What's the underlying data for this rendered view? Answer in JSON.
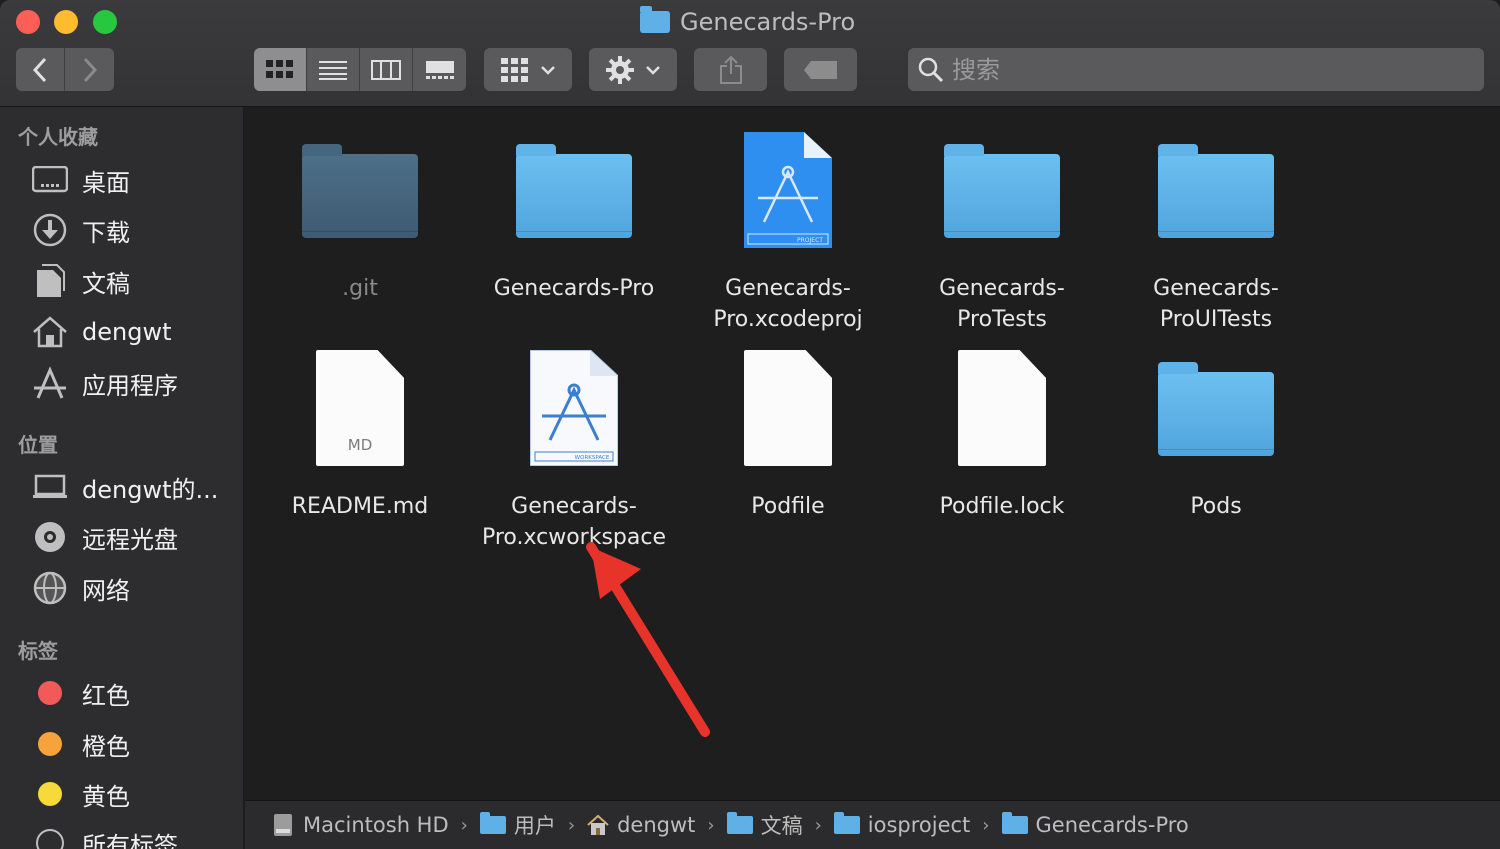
{
  "window": {
    "title": "Genecards-Pro"
  },
  "search": {
    "placeholder": "搜索"
  },
  "sidebar": {
    "sections": [
      {
        "heading": "个人收藏",
        "items": [
          {
            "label": "桌面",
            "icon": "desktop-icon"
          },
          {
            "label": "下载",
            "icon": "download-icon"
          },
          {
            "label": "文稿",
            "icon": "documents-icon"
          },
          {
            "label": "dengwt",
            "icon": "home-icon"
          },
          {
            "label": "应用程序",
            "icon": "applications-icon"
          }
        ]
      },
      {
        "heading": "位置",
        "items": [
          {
            "label": "dengwt的...",
            "icon": "laptop-icon"
          },
          {
            "label": "远程光盘",
            "icon": "disc-icon"
          },
          {
            "label": "网络",
            "icon": "network-icon"
          }
        ]
      },
      {
        "heading": "标签",
        "items": [
          {
            "label": "红色",
            "color": "#f25a5a"
          },
          {
            "label": "橙色",
            "color": "#f7a33c"
          },
          {
            "label": "黄色",
            "color": "#f7d93a"
          },
          {
            "label": "所有标签...",
            "icon": "tag-icon"
          }
        ]
      }
    ]
  },
  "files": [
    {
      "name": ".git",
      "kind": "folder-dark"
    },
    {
      "name": "Genecards-Pro",
      "kind": "folder"
    },
    {
      "name": "Genecards-\nPro.xcodeproj",
      "kind": "xcodeproj",
      "badge": "PROJECT"
    },
    {
      "name": "Genecards-\nProTests",
      "kind": "folder"
    },
    {
      "name": "Genecards-\nProUITests",
      "kind": "folder"
    },
    {
      "name": "README.md",
      "kind": "md",
      "badge": "MD"
    },
    {
      "name": "Genecards-\nPro.xcworkspace",
      "kind": "xcworkspace",
      "badge": "WORKSPACE"
    },
    {
      "name": "Podfile",
      "kind": "doc"
    },
    {
      "name": "Podfile.lock",
      "kind": "doc"
    },
    {
      "name": "Pods",
      "kind": "folder"
    }
  ],
  "pathbar": [
    {
      "label": "Macintosh HD",
      "icon": "hard-drive-icon"
    },
    {
      "label": "用户",
      "icon": "users-folder-icon"
    },
    {
      "label": "dengwt",
      "icon": "home-icon"
    },
    {
      "label": "文稿",
      "icon": "documents-folder-icon"
    },
    {
      "label": "iosproject",
      "icon": "folder-icon"
    },
    {
      "label": "Genecards-Pro",
      "icon": "folder-icon"
    }
  ],
  "colors": {
    "accent": "#5fb0e6",
    "annotation_arrow": "#e8332a"
  }
}
